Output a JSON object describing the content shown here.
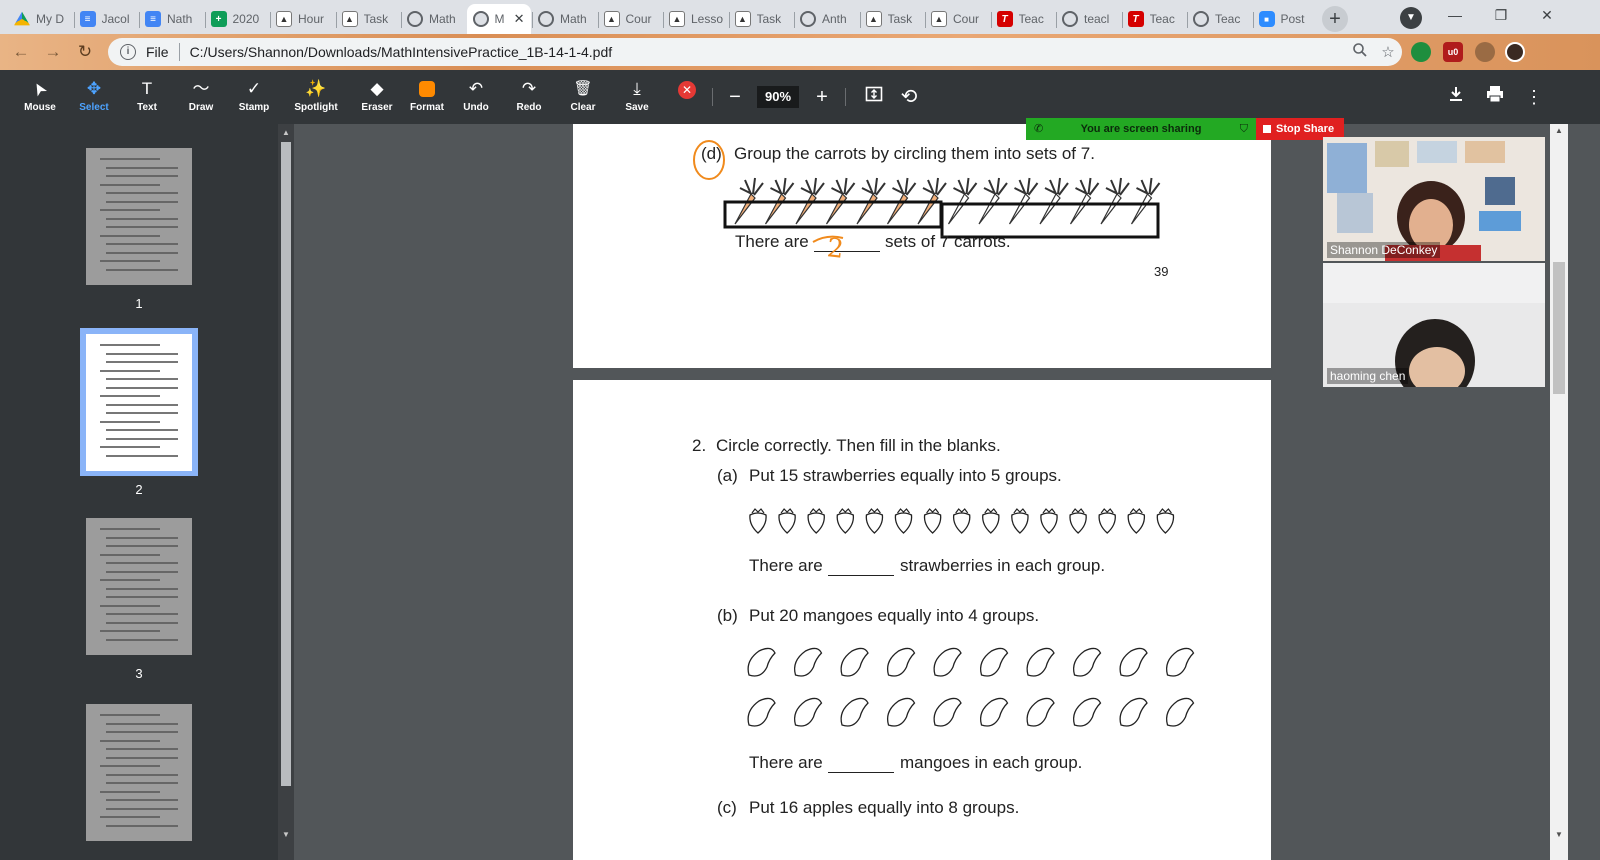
{
  "browser": {
    "tabs": [
      {
        "title": "My D",
        "icon": "drive-icon"
      },
      {
        "title": "Jacol",
        "icon": "docs-icon"
      },
      {
        "title": "Nath",
        "icon": "docs-icon"
      },
      {
        "title": "2020",
        "icon": "sheets-icon"
      },
      {
        "title": "Hour",
        "icon": "classroom-icon"
      },
      {
        "title": "Task",
        "icon": "classroom-icon"
      },
      {
        "title": "Math",
        "icon": "globe-icon"
      },
      {
        "title": "M",
        "icon": "globe-icon",
        "active": true
      },
      {
        "title": "Math",
        "icon": "globe-icon"
      },
      {
        "title": "Cour",
        "icon": "classroom-icon"
      },
      {
        "title": "Lesso",
        "icon": "classroom-icon"
      },
      {
        "title": "Task",
        "icon": "classroom-icon"
      },
      {
        "title": "Anth",
        "icon": "globe-icon"
      },
      {
        "title": "Task",
        "icon": "classroom-icon"
      },
      {
        "title": "Cour",
        "icon": "classroom-icon"
      },
      {
        "title": "Teac",
        "icon": "tpt-icon"
      },
      {
        "title": "teacl",
        "icon": "globe-icon"
      },
      {
        "title": "Teac",
        "icon": "tpt-icon"
      },
      {
        "title": "Teac",
        "icon": "globe-icon"
      },
      {
        "title": "Post",
        "icon": "zoom-icon"
      }
    ],
    "address": {
      "scheme": "File",
      "url": "C:/Users/Shannon/Downloads/MathIntensivePractice_1B-14-1-4.pdf"
    }
  },
  "annotate": {
    "tools": [
      {
        "label": "Mouse",
        "icon": "mouse-pointer-icon"
      },
      {
        "label": "Select",
        "icon": "select-move-icon",
        "selected": true
      },
      {
        "label": "Text",
        "icon": "text-icon"
      },
      {
        "label": "Draw",
        "icon": "draw-icon"
      },
      {
        "label": "Stamp",
        "icon": "stamp-icon"
      },
      {
        "label": "Spotlight",
        "icon": "spotlight-icon"
      },
      {
        "label": "Eraser",
        "icon": "eraser-icon"
      },
      {
        "label": "Format",
        "icon": "format-icon"
      },
      {
        "label": "Undo",
        "icon": "undo-icon"
      },
      {
        "label": "Redo",
        "icon": "redo-icon"
      },
      {
        "label": "Clear",
        "icon": "trash-icon"
      },
      {
        "label": "Save",
        "icon": "save-icon"
      }
    ],
    "format_color": "#ff8a00"
  },
  "pdf": {
    "zoom": "90%",
    "pages": [
      "1",
      "2",
      "3"
    ]
  },
  "share": {
    "sharing_text": "You are screen sharing",
    "stop_label": "Stop Share"
  },
  "participants": [
    "Shannon DeConkey",
    "haoming chen"
  ],
  "worksheet": {
    "d_label": "(d)",
    "d_text": "Group the carrots by circling them into sets of 7.",
    "d_answer_pre": "There are",
    "d_answer_post": "sets of 7 carrots.",
    "d_handwritten": "2",
    "page_number": "39",
    "q2_num": "2.",
    "q2_title": "Circle correctly. Then fill in the blanks.",
    "a_label": "(a)",
    "a_text": "Put 15 strawberries equally into 5 groups.",
    "a_answer_pre": "There are",
    "a_answer_post": "strawberries in each group.",
    "b_label": "(b)",
    "b_text": "Put 20 mangoes equally into 4 groups.",
    "b_answer_pre": "There are",
    "b_answer_post": "mangoes in each group.",
    "c_label": "(c)",
    "c_text": "Put 16 apples equally into 8 groups.",
    "carrot_count": 14,
    "strawberry_count": 15,
    "mango_count": 20,
    "annotation_color": "#f08a1c"
  }
}
